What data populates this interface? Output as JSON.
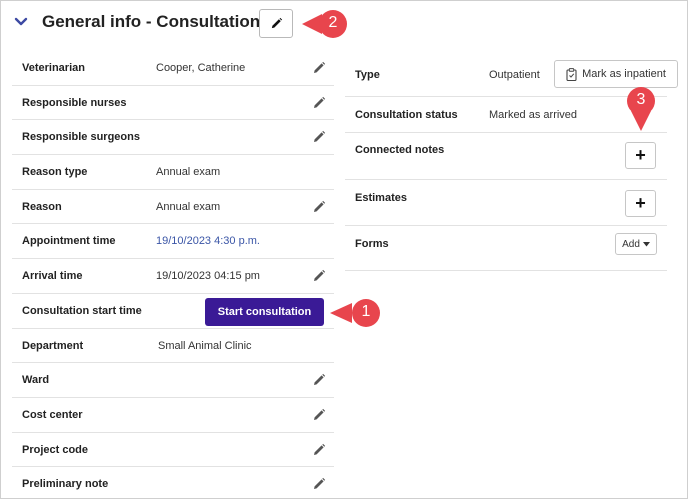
{
  "header": {
    "title": "General info - Consultation",
    "callout_2": "2"
  },
  "left": {
    "rows": [
      {
        "label": "Veterinarian",
        "value": "Cooper, Catherine"
      },
      {
        "label": "Responsible nurses",
        "value": ""
      },
      {
        "label": "Responsible surgeons",
        "value": ""
      },
      {
        "label": "Reason type",
        "value": "Annual exam"
      },
      {
        "label": "Reason",
        "value": "Annual exam"
      },
      {
        "label": "Appointment time",
        "value": "19/10/2023 4:30 p.m."
      },
      {
        "label": "Arrival time",
        "value": "19/10/2023 04:15 pm"
      },
      {
        "label": "Consultation start time",
        "value": ""
      },
      {
        "label": "Department",
        "value": "Small Animal Clinic"
      },
      {
        "label": "Ward",
        "value": ""
      },
      {
        "label": "Cost center",
        "value": ""
      },
      {
        "label": "Project code",
        "value": ""
      },
      {
        "label": "Preliminary note",
        "value": ""
      }
    ],
    "start_consultation_label": "Start consultation",
    "callout_1": "1"
  },
  "right": {
    "type_label": "Type",
    "type_value": "Outpatient",
    "mark_inpatient_label": "Mark as inpatient",
    "status_label": "Consultation status",
    "status_value": "Marked as arrived",
    "connected_notes_label": "Connected notes",
    "estimates_label": "Estimates",
    "forms_label": "Forms",
    "add_label": "Add",
    "plus_symbol": "+",
    "callout_3": "3"
  },
  "colors": {
    "accent": "#3a1a96",
    "link": "#3a55a6",
    "callout": "#e8454d",
    "chevron": "#3d4aa3"
  },
  "icons": [
    "chevron-down-icon",
    "pencil-icon",
    "clipboard-icon",
    "plus-icon",
    "caret-down-icon"
  ]
}
